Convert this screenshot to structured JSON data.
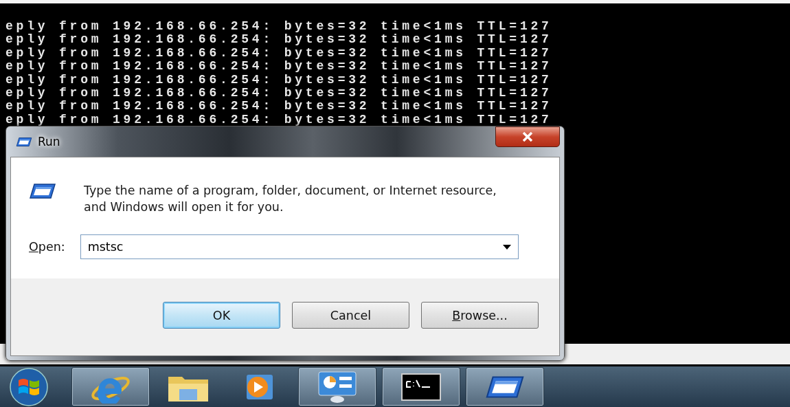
{
  "console": {
    "lines": [
      "eply from 192.168.66.254: bytes=32 time<1ms TTL=127",
      "eply from 192.168.66.254: bytes=32 time<1ms TTL=127",
      "eply from 192.168.66.254: bytes=32 time<1ms TTL=127",
      "eply from 192.168.66.254: bytes=32 time<1ms TTL=127",
      "eply from 192.168.66.254: bytes=32 time<1ms TTL=127",
      "eply from 192.168.66.254: bytes=32 time<1ms TTL=127",
      "eply from 192.168.66.254: bytes=32 time<1ms TTL=127",
      "eply from 192.168.66.254: bytes=32 time<1ms TTL=127"
    ]
  },
  "dialog": {
    "title": "Run",
    "message": "Type the name of a program, folder, document, or Internet resource, and Windows will open it for you.",
    "open_label": "Open:",
    "value": "mstsc",
    "buttons": [
      {
        "label": "OK",
        "default": true
      },
      {
        "label": "Cancel",
        "default": false
      },
      {
        "label": "Browse...",
        "default": false
      }
    ]
  },
  "taskbar": {
    "items": [
      {
        "kind": "browser",
        "active": true
      },
      {
        "kind": "folder",
        "active": false
      },
      {
        "kind": "media",
        "active": false
      },
      {
        "kind": "control",
        "active": true
      },
      {
        "kind": "terminal",
        "active": true
      },
      {
        "kind": "run",
        "active": true
      }
    ]
  }
}
